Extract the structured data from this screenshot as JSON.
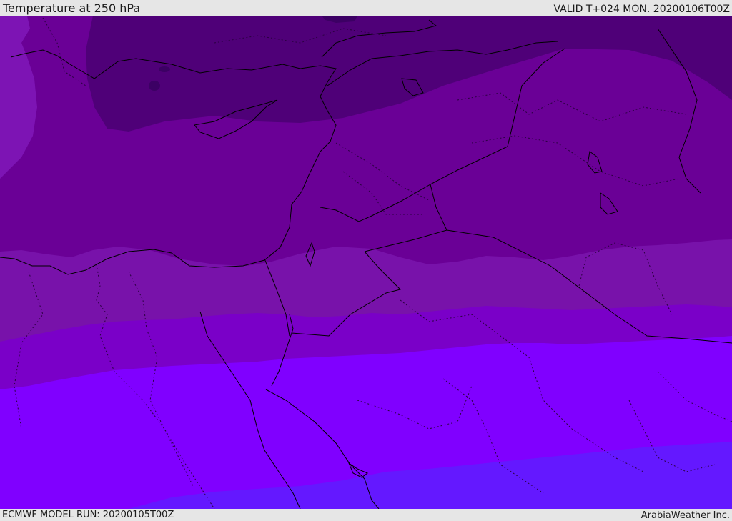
{
  "header": {
    "title": "Temperature at 250 hPa",
    "valid": "VALID T+024 MON. 20200106T00Z"
  },
  "footer": {
    "model_run": "ECMWF MODEL RUN: 20200105T00Z",
    "credit": "ArabiaWeather Inc."
  },
  "colors": {
    "band_coldest": "#3c0064",
    "band_very_cold": "#4f0078",
    "band_cold": "#6a0096",
    "band_cool": "#7812aa",
    "band_mid": "#7a00c8",
    "band_warm": "#8000ff",
    "band_warmest": "#6418ff",
    "west_lobe": "#7d14b4",
    "coastline": "#000000",
    "border": "#2a0040"
  }
}
